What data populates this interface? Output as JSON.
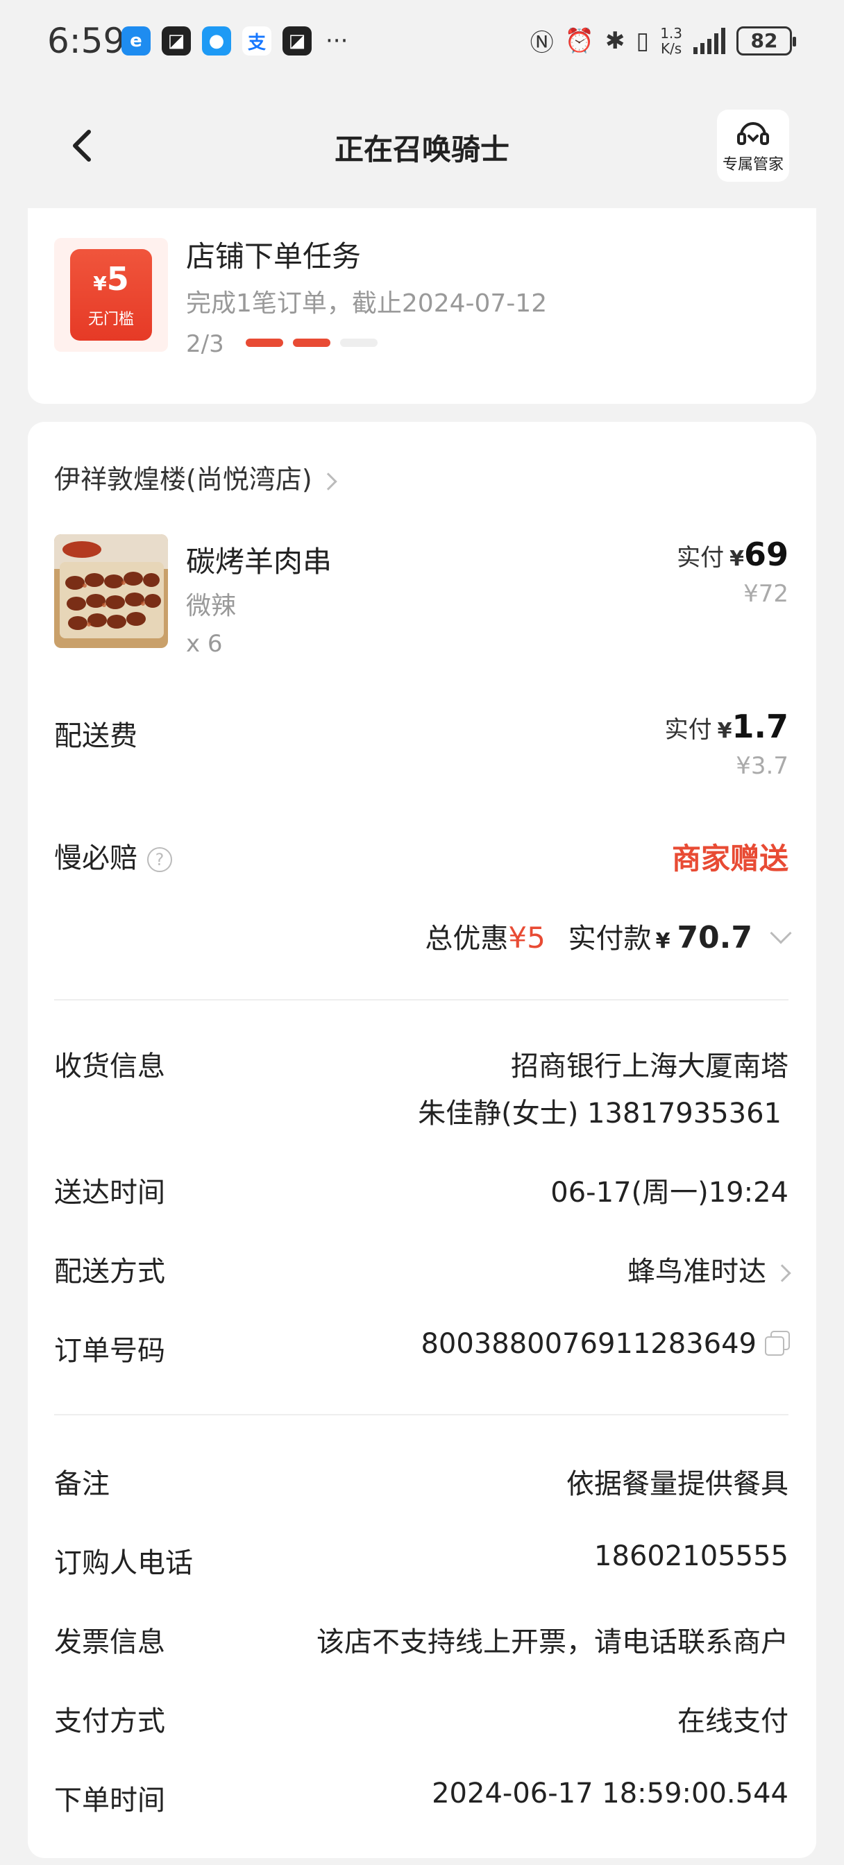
{
  "status_bar": {
    "time": "6:59",
    "more": "···",
    "speed_value": "1.3",
    "speed_unit": "K/s",
    "battery": "82"
  },
  "nav": {
    "title": "正在召唤骑士",
    "manager_label": "专属管家"
  },
  "task": {
    "coupon_currency": "¥",
    "coupon_amount": "5",
    "coupon_label": "无门槛",
    "title": "店铺下单任务",
    "description": "完成1笔订单，截止2024-07-12",
    "progress_text": "2/3",
    "progress_done": 2,
    "progress_total": 3
  },
  "order": {
    "shop_name": "伊祥敦煌楼(尚悦湾店)",
    "item": {
      "name": "碳烤羊肉串",
      "spec": "微辣",
      "quantity": "x 6",
      "paid_label": "实付",
      "currency": "¥",
      "paid_amount": "69",
      "original_price": "¥72"
    },
    "delivery_fee": {
      "label": "配送费",
      "paid_label": "实付",
      "currency": "¥",
      "paid_amount": "1.7",
      "original_price": "¥3.7"
    },
    "slow_compensation": {
      "label": "慢必赔",
      "help": "?",
      "value": "商家赠送"
    },
    "summary": {
      "discount_label": "总优惠",
      "discount_value": "¥5",
      "paid_label": "实付款",
      "currency": "¥",
      "paid_amount": "70.7"
    },
    "details": {
      "receiver_label": "收货信息",
      "receiver_address": "招商银行上海大厦南塔",
      "receiver_contact": "朱佳静(女士) 13817935361",
      "delivery_time_label": "送达时间",
      "delivery_time": "06-17(周一)19:24",
      "delivery_method_label": "配送方式",
      "delivery_method": "蜂鸟准时达",
      "order_number_label": "订单号码",
      "order_number": "8003880076911283649",
      "remark_label": "备注",
      "remark": "依据餐量提供餐具",
      "buyer_phone_label": "订购人电话",
      "buyer_phone": "18602105555",
      "invoice_label": "发票信息",
      "invoice": "该店不支持线上开票，请电话联系商户",
      "payment_label": "支付方式",
      "payment": "在线支付",
      "order_time_label": "下单时间",
      "order_time": "2024-06-17 18:59:00.544"
    }
  },
  "colors": {
    "accent": "#e84b34",
    "background": "#f2f2f2",
    "muted": "#999999"
  }
}
